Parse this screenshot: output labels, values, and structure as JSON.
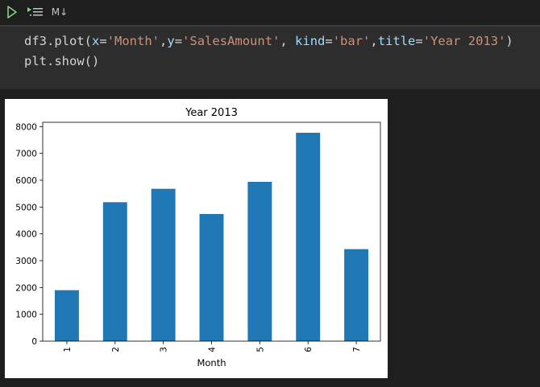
{
  "toolbar": {
    "run_icon": "play-icon",
    "run_below_icon": "run-below-icon",
    "markdown_label": "M↓"
  },
  "code": {
    "line1": {
      "p1": "df3.plot(",
      "k1": "x",
      "p2": "=",
      "s1": "'Month'",
      "p3": ",",
      "k2": "y",
      "p4": "=",
      "s2": "'SalesAmount'",
      "p5": ", ",
      "k3": "kind",
      "p6": "=",
      "s3": "'bar'",
      "p7": ",",
      "k4": "title",
      "p8": "=",
      "s4": "'Year 2013'",
      "p9": ")"
    },
    "line2": "plt.show()"
  },
  "colors": {
    "bar": "#1f77b4",
    "editor_bg": "#1e1e1e",
    "cell_bg": "#2d2d2d"
  },
  "chart_data": {
    "type": "bar",
    "title": "Year 2013",
    "xlabel": "Month",
    "ylabel": "",
    "categories": [
      "1",
      "2",
      "3",
      "4",
      "5",
      "6",
      "7"
    ],
    "values": [
      1900,
      5180,
      5680,
      4740,
      5940,
      7770,
      3430
    ],
    "ylim": [
      0,
      8160
    ],
    "yticks": [
      0,
      1000,
      2000,
      3000,
      4000,
      5000,
      6000,
      7000,
      8000
    ],
    "grid": false,
    "legend": "none"
  }
}
